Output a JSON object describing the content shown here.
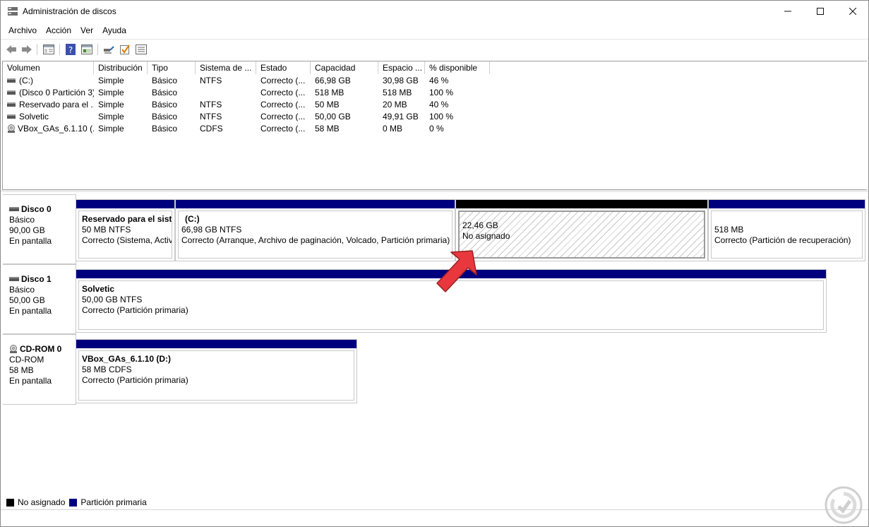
{
  "window": {
    "title": "Administración de discos",
    "min": "—",
    "max": "☐",
    "close": "✕"
  },
  "menu": [
    "Archivo",
    "Acción",
    "Ver",
    "Ayuda"
  ],
  "toolbar": [
    "back-icon",
    "forward-icon",
    "console-tree-icon",
    "help-icon",
    "properties-icon",
    "connect-icon",
    "check-icon",
    "list-icon"
  ],
  "columns": [
    "Volumen",
    "Distribución",
    "Tipo",
    "Sistema de ...",
    "Estado",
    "Capacidad",
    "Espacio ...",
    "% disponible"
  ],
  "volumes": [
    {
      "name": "(C:)",
      "layout": "Simple",
      "type": "Básico",
      "fs": "NTFS",
      "status": "Correcto (...",
      "capacity": "66,98 GB",
      "free": "30,98 GB",
      "pct": "46 %",
      "icon": "disk-volume-icon"
    },
    {
      "name": "(Disco 0 Partición 3)",
      "layout": "Simple",
      "type": "Básico",
      "fs": "",
      "status": "Correcto (...",
      "capacity": "518 MB",
      "free": "518 MB",
      "pct": "100 %",
      "icon": "disk-volume-icon"
    },
    {
      "name": "Reservado para el ...",
      "layout": "Simple",
      "type": "Básico",
      "fs": "NTFS",
      "status": "Correcto (...",
      "capacity": "50 MB",
      "free": "20 MB",
      "pct": "40 %",
      "icon": "disk-volume-icon"
    },
    {
      "name": "Solvetic",
      "layout": "Simple",
      "type": "Básico",
      "fs": "NTFS",
      "status": "Correcto (...",
      "capacity": "50,00 GB",
      "free": "49,91 GB",
      "pct": "100 %",
      "icon": "disk-volume-icon"
    },
    {
      "name": "VBox_GAs_6.1.10 (...",
      "layout": "Simple",
      "type": "Básico",
      "fs": "CDFS",
      "status": "Correcto (...",
      "capacity": "58 MB",
      "free": "0 MB",
      "pct": "0 %",
      "icon": "cd-icon"
    }
  ],
  "disks": [
    {
      "name": "Disco 0",
      "kind": "Básico",
      "size": "90,00 GB",
      "state": "En pantalla",
      "partitions": [
        {
          "title": "Reservado para el siste",
          "line2": "50 MB NTFS",
          "line3": "Correcto (Sistema, Activ"
        },
        {
          "title": "(C:)",
          "line2": "66,98 GB NTFS",
          "line3": "Correcto (Arranque, Archivo de paginación, Volcado, Partición primaria)"
        },
        {
          "title": "",
          "line2": "22,46 GB",
          "line3": "No asignado"
        },
        {
          "title": "",
          "line2": "518 MB",
          "line3": "Correcto (Partición de recuperación)"
        }
      ]
    },
    {
      "name": "Disco 1",
      "kind": "Básico",
      "size": "50,00 GB",
      "state": "En pantalla",
      "partitions": [
        {
          "title": "Solvetic",
          "line2": "50,00 GB NTFS",
          "line3": "Correcto (Partición primaria)"
        }
      ]
    },
    {
      "name": "CD-ROM 0",
      "kind": "CD-ROM",
      "size": "58 MB",
      "state": "En pantalla",
      "partitions": [
        {
          "title": "VBox_GAs_6.1.10  (D:)",
          "line2": "58 MB CDFS",
          "line3": "Correcto (Partición primaria)"
        }
      ]
    }
  ],
  "legend": [
    {
      "label": "No asignado",
      "color": "#000000"
    },
    {
      "label": "Partición primaria",
      "color": "#00007f"
    }
  ],
  "colors": {
    "primary": "#00007f",
    "unallocated": "#000000",
    "arrow": "#e8383d"
  }
}
